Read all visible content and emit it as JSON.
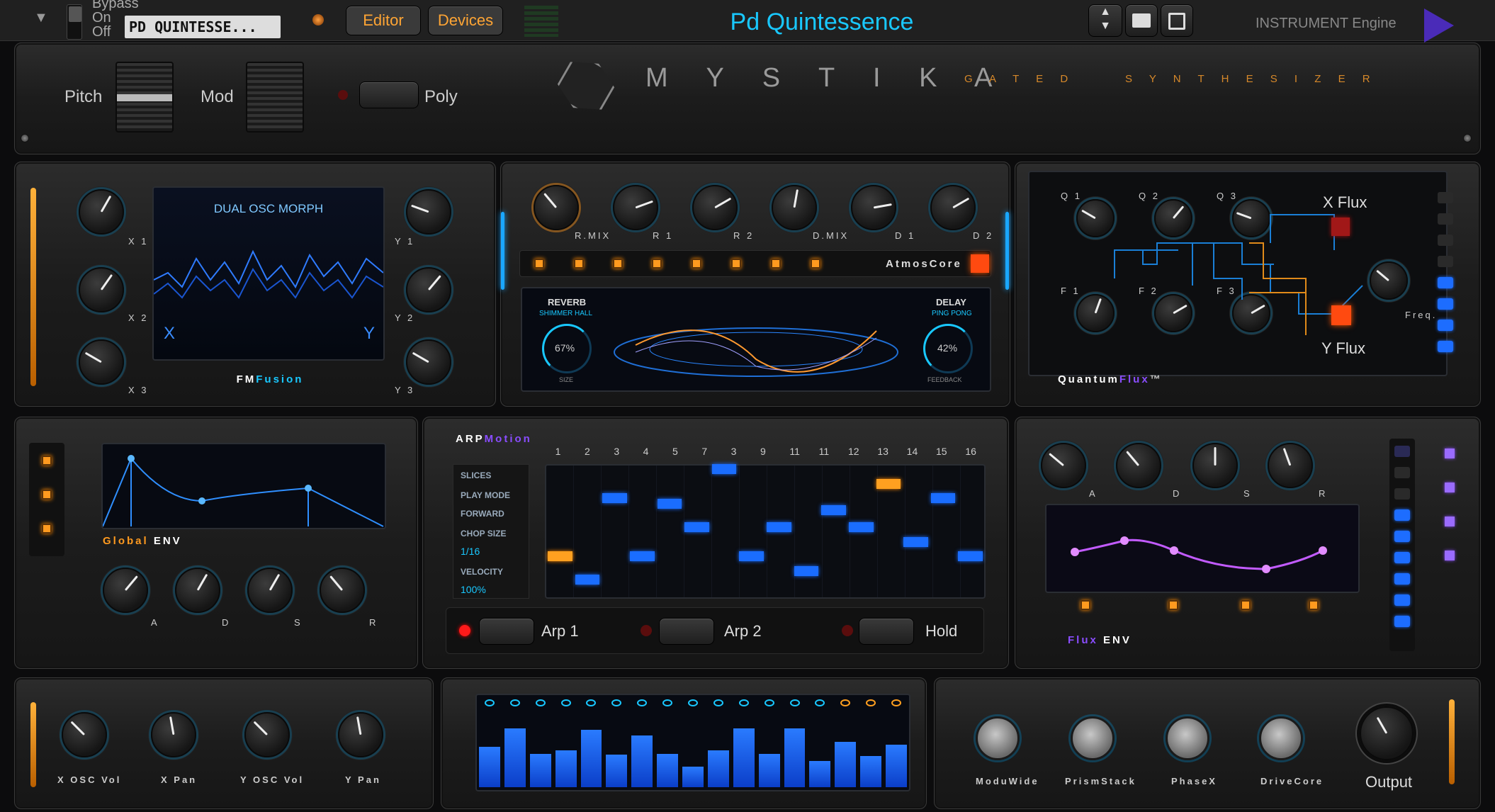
{
  "topbar": {
    "bypass": "Bypass",
    "on": "On",
    "off": "Off",
    "preset": "PD QUINTESSE...",
    "editor": "Editor",
    "devices": "Devices",
    "title": "Pd Quintessence",
    "engine": "INSTRUMENT Engine"
  },
  "header": {
    "pitch": "Pitch",
    "mod": "Mod",
    "poly": "Poly",
    "brand": "M Y S T I K A",
    "sub": "G A T E D     S Y N T H E S I Z E R"
  },
  "fm": {
    "screen_title": "DUAL OSC MORPH",
    "x": "X",
    "y": "Y",
    "name_a": "FM",
    "name_b": "Fusion",
    "knobs_left": [
      "X 1",
      "X 2",
      "X 3"
    ],
    "knobs_right": [
      "Y 1",
      "Y 2",
      "Y 3"
    ]
  },
  "atmos": {
    "knobs": [
      "R.MIX",
      "R 1",
      "R 2",
      "D.MIX",
      "D 1",
      "D 2"
    ],
    "name": "AtmosCore",
    "reverb": "REVERB",
    "reverb_sub": "SHIMMER HALL",
    "reverb_val": "67%",
    "reverb_knob": "SIZE",
    "delay": "DELAY",
    "delay_sub": "PING PONG",
    "delay_val": "42%",
    "delay_knob": "FEEDBACK"
  },
  "quantum": {
    "knobs_top": [
      "Q 1",
      "Q 2",
      "Q 3"
    ],
    "knobs_bottom": [
      "F 1",
      "F 2",
      "F 3"
    ],
    "xflux": "X Flux",
    "yflux": "Y Flux",
    "freq": "Freq.",
    "name_a": "Quantum",
    "name_b": "Flux",
    "tm": "™"
  },
  "genv": {
    "name_a": "Global",
    "name_b": "ENV",
    "knobs": [
      "A",
      "D",
      "S",
      "R"
    ]
  },
  "arp": {
    "title_a": "ARP",
    "title_b": "Motion",
    "steps": [
      "1",
      "2",
      "3",
      "4",
      "5",
      "7",
      "3",
      "9",
      "11",
      "11",
      "12",
      "13",
      "14",
      "15",
      "16"
    ],
    "params": [
      {
        "k": "SLICES",
        "v": ""
      },
      {
        "k": "PLAY MODE",
        "v": "FORWARD"
      },
      {
        "k": "CHOP SIZE",
        "v": "1/16"
      },
      {
        "k": "VELOCITY",
        "v": "100%"
      }
    ],
    "arp1": "Arp 1",
    "arp2": "Arp 2",
    "hold": "Hold",
    "notes": [
      0.1,
      0.02,
      0.3,
      0.1,
      0.28,
      0.2,
      0.4,
      0.1,
      0.2,
      0.05,
      0.26,
      0.2,
      0.35,
      0.15,
      0.3,
      0.1
    ],
    "accents": [
      0,
      12
    ]
  },
  "fenv": {
    "knobs": [
      "A",
      "D",
      "S",
      "R"
    ],
    "name_a": "Flux",
    "name_b": "ENV"
  },
  "mix": {
    "knobs": [
      "X OSC Vol",
      "X Pan",
      "Y OSC Vol",
      "Y Pan"
    ]
  },
  "seqbars": [
    0.55,
    0.8,
    0.45,
    0.5,
    0.78,
    0.44,
    0.7,
    0.45,
    0.28,
    0.5,
    0.8,
    0.45,
    0.8,
    0.36,
    0.62,
    0.42,
    0.58
  ],
  "fx": {
    "knobs": [
      "ModuWide",
      "PrismStack",
      "PhaseX",
      "DriveCore"
    ],
    "output": "Output"
  },
  "colors": {
    "accent_cyan": "#19c8ff",
    "accent_orange": "#ff9a1f",
    "accent_purple": "#8a4dff",
    "brand_orange": "#d6882a"
  }
}
